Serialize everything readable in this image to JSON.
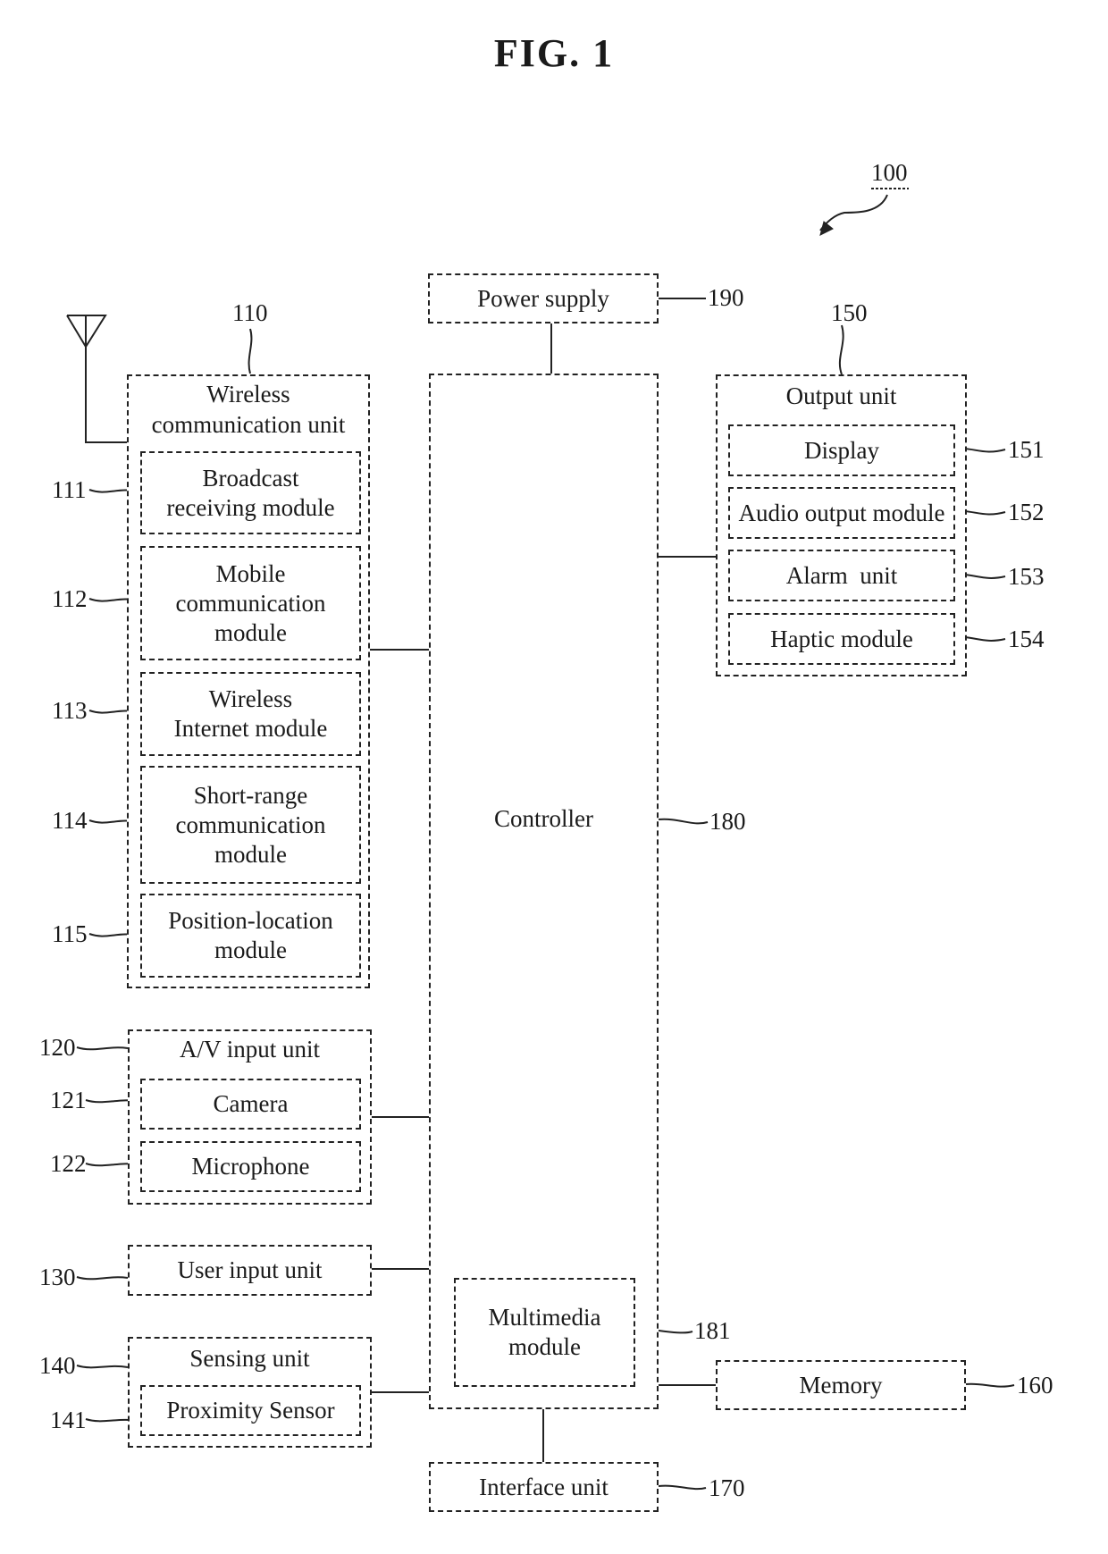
{
  "figure": {
    "title": "FIG. 1",
    "ref": "100"
  },
  "power_supply": {
    "label": "Power supply",
    "ref": "190"
  },
  "controller": {
    "label": "Controller",
    "ref": "180",
    "multimedia": {
      "label_line1": "Multimedia",
      "label_line2": "module",
      "ref": "181"
    }
  },
  "wireless": {
    "label_line1": "Wireless",
    "label_line2": "communication unit",
    "ref": "110",
    "modules": [
      {
        "lines": [
          "Broadcast",
          "receiving module"
        ],
        "ref": "111"
      },
      {
        "lines": [
          "Mobile",
          "communication",
          "module"
        ],
        "ref": "112"
      },
      {
        "lines": [
          "Wireless",
          "Internet module"
        ],
        "ref": "113"
      },
      {
        "lines": [
          "Short-range",
          "communication",
          "module"
        ],
        "ref": "114"
      },
      {
        "lines": [
          "Position-location",
          "module"
        ],
        "ref": "115"
      }
    ]
  },
  "av_input": {
    "label": "A/V input unit",
    "ref": "120",
    "modules": [
      {
        "label": "Camera",
        "ref": "121"
      },
      {
        "label": "Microphone",
        "ref": "122"
      }
    ]
  },
  "user_input": {
    "label": "User input unit",
    "ref": "130"
  },
  "sensing": {
    "label": "Sensing unit",
    "ref": "140",
    "modules": [
      {
        "label": "Proximity Sensor",
        "ref": "141"
      }
    ]
  },
  "output": {
    "label": "Output unit",
    "ref": "150",
    "modules": [
      {
        "label": "Display",
        "ref": "151"
      },
      {
        "label": "Audio output module",
        "ref": "152"
      },
      {
        "label": "Alarm  unit",
        "ref": "153"
      },
      {
        "label": "Haptic module",
        "ref": "154"
      }
    ]
  },
  "memory": {
    "label": "Memory",
    "ref": "160"
  },
  "interface": {
    "label": "Interface unit",
    "ref": "170"
  }
}
